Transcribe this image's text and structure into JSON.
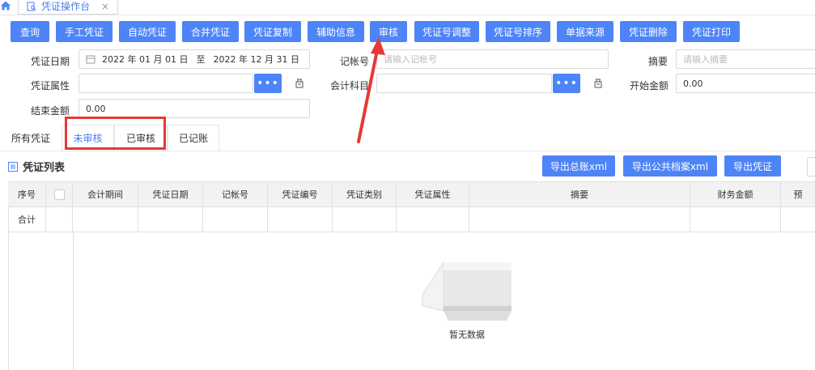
{
  "top_tab": {
    "title": "凭证操作台",
    "close": "×"
  },
  "toolbar": {
    "buttons": [
      "查询",
      "手工凭证",
      "自动凭证",
      "合并凭证",
      "凭证复制",
      "辅助信息",
      "审核",
      "凭证号调整",
      "凭证号排序",
      "单据来源",
      "凭证删除",
      "凭证打印"
    ]
  },
  "form": {
    "voucher_date_label": "凭证日期",
    "date_start": "2022 年 01 月 01 日",
    "date_to": "至",
    "date_end": "2022 年 12 月 31 日",
    "account_no_label": "记帐号",
    "account_no_placeholder": "请输入记帐号",
    "summary_label": "摘要",
    "summary_placeholder": "请输入摘要",
    "voucher_attr_label": "凭证属性",
    "account_subject_label": "会计科目",
    "dots": "•••",
    "start_amount_label": "开始金额",
    "start_amount_value": "0.00",
    "end_amount_label": "结束金额",
    "end_amount_value": "0.00"
  },
  "tabs": [
    "所有凭证",
    "未审核",
    "已审核",
    "已记账"
  ],
  "list": {
    "title": "凭证列表",
    "actions": [
      "导出总账xml",
      "导出公共档案xml",
      "导出凭证"
    ]
  },
  "table": {
    "columns": [
      "序号",
      "",
      "会计期间",
      "凭证日期",
      "记帐号",
      "凭证编号",
      "凭证类别",
      "凭证属性",
      "摘要",
      "财务金额",
      "预"
    ],
    "total_row_label": "合计"
  },
  "empty_text": "暂无数据",
  "colors": {
    "primary": "#4d84f7",
    "highlight": "#e53935",
    "active_tab": "#4c7df0"
  }
}
